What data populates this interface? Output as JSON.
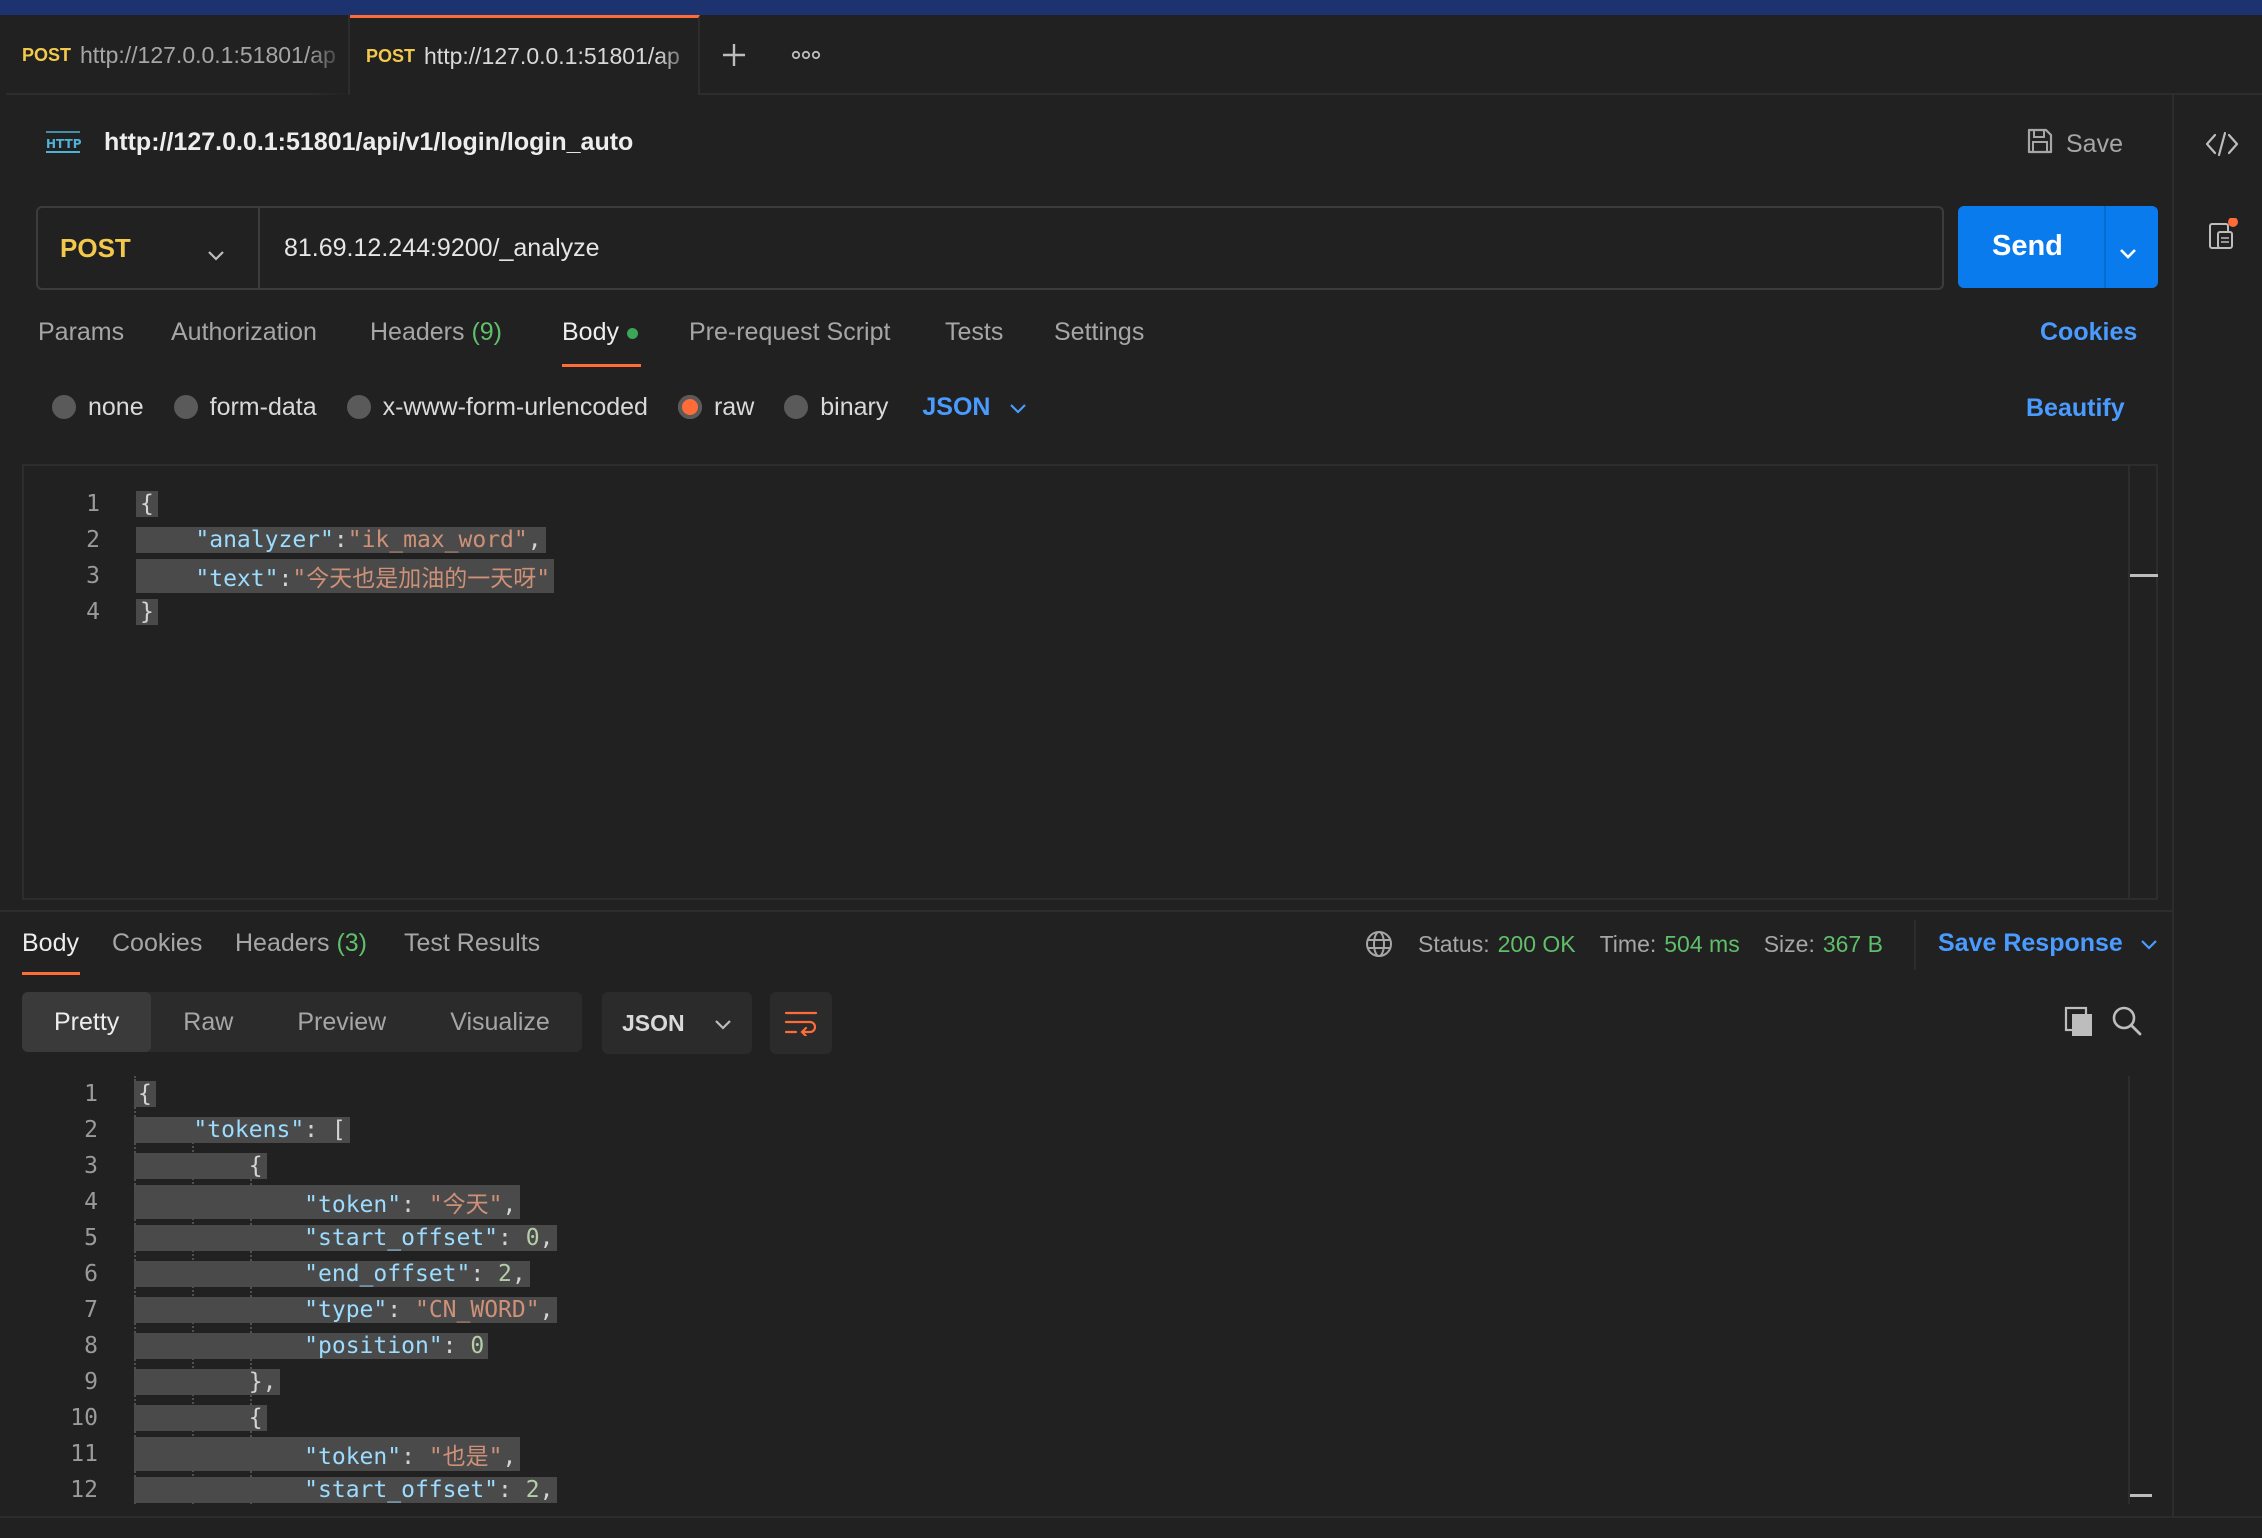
{
  "tabs": [
    {
      "method": "POST",
      "url": "http://127.0.0.1:51801/ap",
      "active": false
    },
    {
      "method": "POST",
      "url": "http://127.0.0.1:51801/ap",
      "active": true
    }
  ],
  "icons": {
    "new_tab": "plus-icon",
    "more": "ellipsis-icon",
    "code": "code-icon",
    "context": "clipboard-icon",
    "http": "http-icon",
    "save": "floppy-icon",
    "globe": "globe-icon",
    "copy": "copy-icon",
    "search": "search-icon",
    "wrap": "wrap-lines-icon"
  },
  "request": {
    "name": "http://127.0.0.1:51801/api/v1/login/login_auto",
    "save_label": "Save",
    "method": "POST",
    "url": "81.69.12.244:9200/_analyze",
    "send_label": "Send"
  },
  "request_tabs": {
    "params": "Params",
    "authorization": "Authorization",
    "headers": "Headers",
    "headers_count": "(9)",
    "body": "Body",
    "prerequest": "Pre-request Script",
    "tests": "Tests",
    "settings": "Settings",
    "cookies": "Cookies"
  },
  "body_types": {
    "none": "none",
    "form_data": "form-data",
    "urlencoded": "x-www-form-urlencoded",
    "raw": "raw",
    "binary": "binary",
    "selected": "raw",
    "format": "JSON",
    "beautify": "Beautify"
  },
  "request_body": {
    "line_numbers": [
      "1",
      "2",
      "3",
      "4"
    ],
    "open_brace": "{",
    "key_analyzer": "\"analyzer\"",
    "colon1": ":",
    "val_analyzer": "\"ik_max_word\"",
    "comma1": ",",
    "key_text": "\"text\"",
    "colon2": ":",
    "val_text": "\"今天也是加油的一天呀\"",
    "close_brace": "}"
  },
  "response_tabs": {
    "body": "Body",
    "cookies": "Cookies",
    "headers": "Headers",
    "headers_count": "(3)",
    "test_results": "Test Results"
  },
  "status": {
    "status_label": "Status:",
    "status_value": "200 OK",
    "time_label": "Time:",
    "time_value": "504 ms",
    "size_label": "Size:",
    "size_value": "367 B",
    "save_response": "Save Response"
  },
  "response_views": {
    "pretty": "Pretty",
    "raw": "Raw",
    "preview": "Preview",
    "visualize": "Visualize",
    "format": "JSON"
  },
  "response_body": {
    "line_numbers": [
      "1",
      "2",
      "3",
      "4",
      "5",
      "6",
      "7",
      "8",
      "9",
      "10",
      "11",
      "12"
    ],
    "l1": "{",
    "l2_key": "\"tokens\"",
    "l2_rest": ": [",
    "l3": "{",
    "l4_key": "\"token\"",
    "l4_val": "\"今天\"",
    "l5_key": "\"start_offset\"",
    "l5_val": "0",
    "l6_key": "\"end_offset\"",
    "l6_val": "2",
    "l7_key": "\"type\"",
    "l7_val": "\"CN_WORD\"",
    "l8_key": "\"position\"",
    "l8_val": "0",
    "l9": "},",
    "l10": "{",
    "l11_key": "\"token\"",
    "l11_val": "\"也是\"",
    "l12_key": "\"start_offset\"",
    "l12_val": "2"
  },
  "colors": {
    "accent": "#ff6c37",
    "send_blue": "#097bed",
    "link_blue": "#4a9bff",
    "status_green": "#5fbf6b",
    "method_yellow": "#f2c94c"
  }
}
